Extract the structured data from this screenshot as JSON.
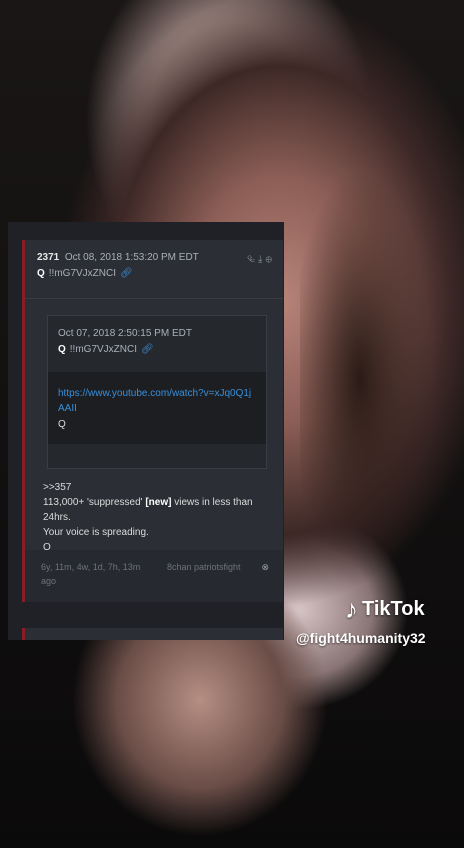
{
  "post": {
    "number": "2371",
    "datetime": "Oct 08, 2018 1:53:20 PM EDT",
    "author": "Q",
    "tripcode": "!!mG7VJxZNCI",
    "quoted": {
      "datetime": "Oct 07, 2018 2:50:15 PM EDT",
      "author": "Q",
      "tripcode": "!!mG7VJxZNCI",
      "link": "https://www.youtube.com/watch?v=xJq0Q1jAAII",
      "signature": "Q"
    },
    "body": {
      "ref": ">>357",
      "line1_pre": "113,000+ 'suppressed' ",
      "line1_new": "[new]",
      "line1_post": " views in less than 24hrs.",
      "line2": "Your voice is spreading.",
      "signature": "Q"
    },
    "footer": {
      "age": "6y, 11m, 4w, 1d, 7h, 13m ago",
      "board": "8chan patriotsfight"
    }
  },
  "overlay": {
    "brand": "TikTok",
    "handle": "@fight4humanity32"
  },
  "icons": [
    "share-icon",
    "download-icon",
    "target-icon",
    "link-icon",
    "close-icon",
    "tiktok-logo-icon"
  ],
  "colors": {
    "accent_red": "#8b1c24",
    "link_blue": "#3a8fd9",
    "card_bg": "#2b2e34"
  }
}
